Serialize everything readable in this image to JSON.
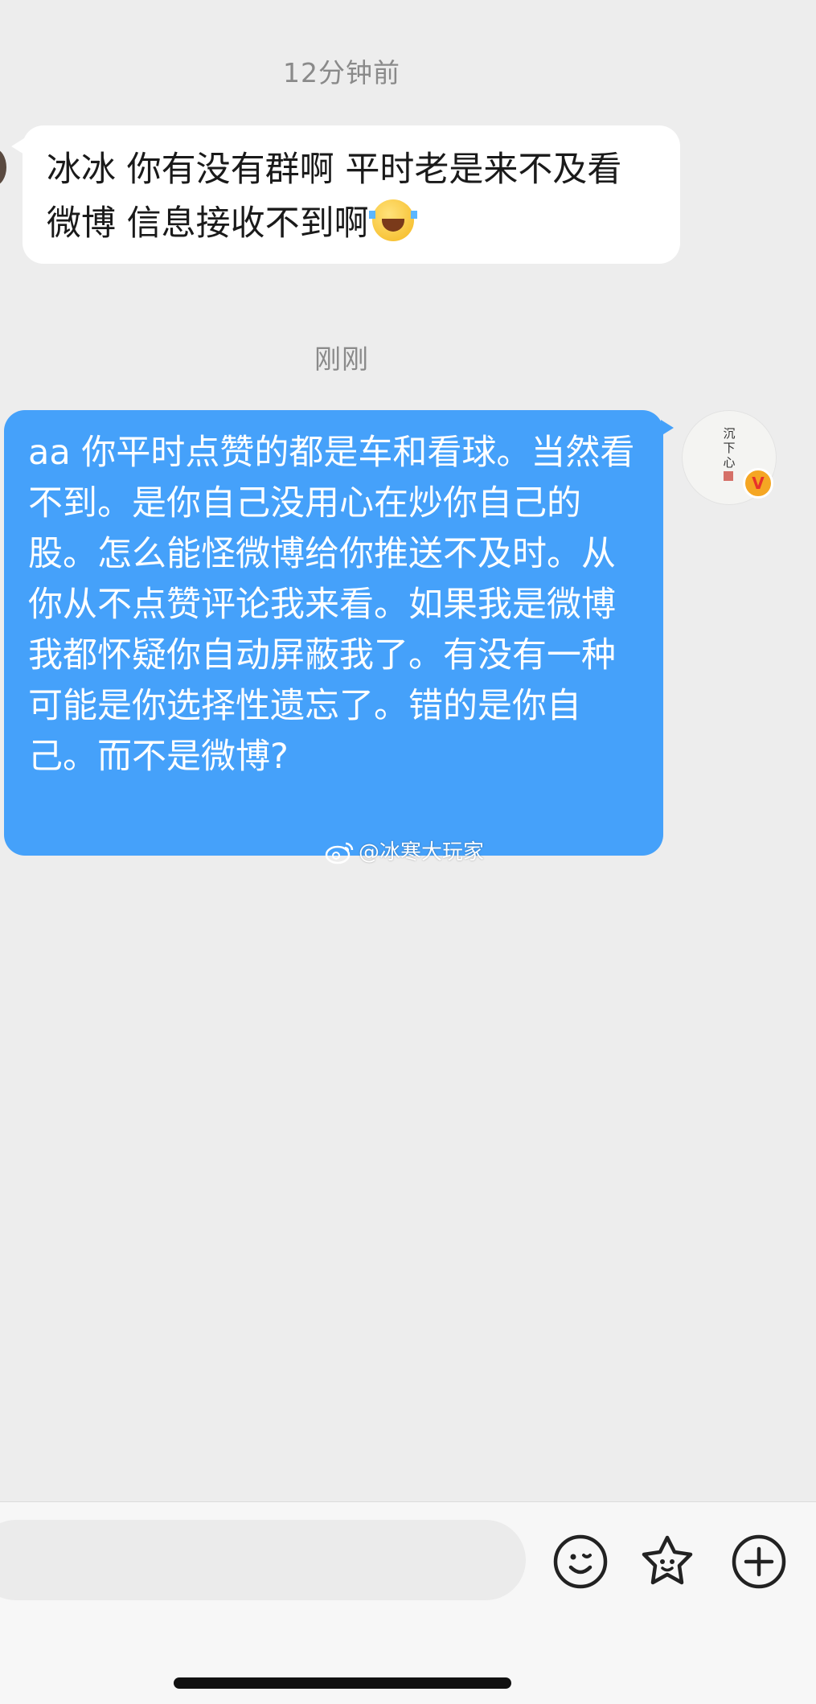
{
  "messages": [
    {
      "timestamp": "12分钟前",
      "sender": "other",
      "text": "冰冰 你有没有群啊 平时老是来不及看微博 信息接收不到啊",
      "emoji": "laughing-with-tears-emoji"
    },
    {
      "timestamp": "刚刚",
      "sender": "self",
      "text": "aa 你平时点赞的都是车和看球。当然看不到。是你自己没用心在炒你自己的股。怎么能怪微博给你推送不及时。从你从不点赞评论我来看。如果我是微博我都怀疑你自动屏蔽我了。有没有一种可能是你选择性遗忘了。错的是你自己。而不是微博?"
    }
  ],
  "avatar_right": {
    "calligraphy_text": "沉下心",
    "badge_text": "V"
  },
  "watermark": {
    "text": "@冰寒大玩家",
    "icon": "weibo-logo-icon"
  },
  "input_bar": {
    "placeholder": "",
    "icons": [
      "emoji-icon",
      "sticker-icon",
      "plus-icon"
    ]
  },
  "colors": {
    "background": "#ededed",
    "received_bubble": "#ffffff",
    "sent_bubble": "#45a1fa",
    "timestamp_text": "#8a8a8a",
    "verified_badge": "#f5a623"
  }
}
